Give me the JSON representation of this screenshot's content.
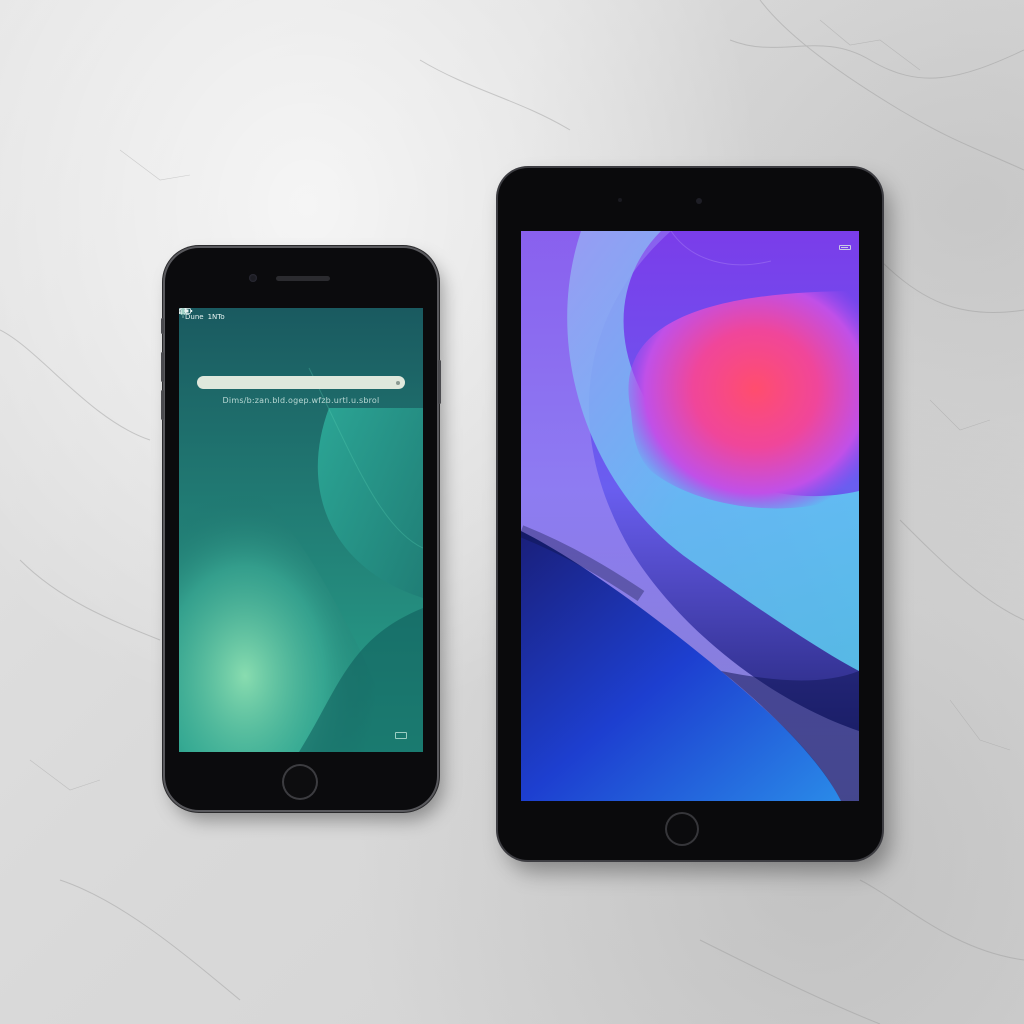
{
  "scene": {
    "background_colors": {
      "surface": "#dcdcdc",
      "veins": "#9a9a9a"
    }
  },
  "phone": {
    "status_bar": {
      "carrier_text": "Dune",
      "network_text": "1NTo",
      "wifi_icon": "wifi-icon",
      "signal_icon": "signal-icon",
      "battery_icon": "battery-icon"
    },
    "search_caption": "Dims/b:zan.bld.ogep.wfzb.urtl.u.sbrol",
    "icons": {
      "mic": "mic-icon",
      "keyboard": "keyboard-icon"
    },
    "colors": {
      "screen_top": "#0f3d44",
      "screen_mid": "#1f8578",
      "accent_light": "#8ee0b2"
    }
  },
  "tablet": {
    "icons": {
      "battery": "battery-icon"
    },
    "colors": {
      "purple": "#7a3dea",
      "magenta": "#f0469a",
      "red": "#ff4d6e",
      "cyan": "#5cd0f2",
      "blue": "#1d3fd0",
      "navy": "#12185a"
    }
  }
}
